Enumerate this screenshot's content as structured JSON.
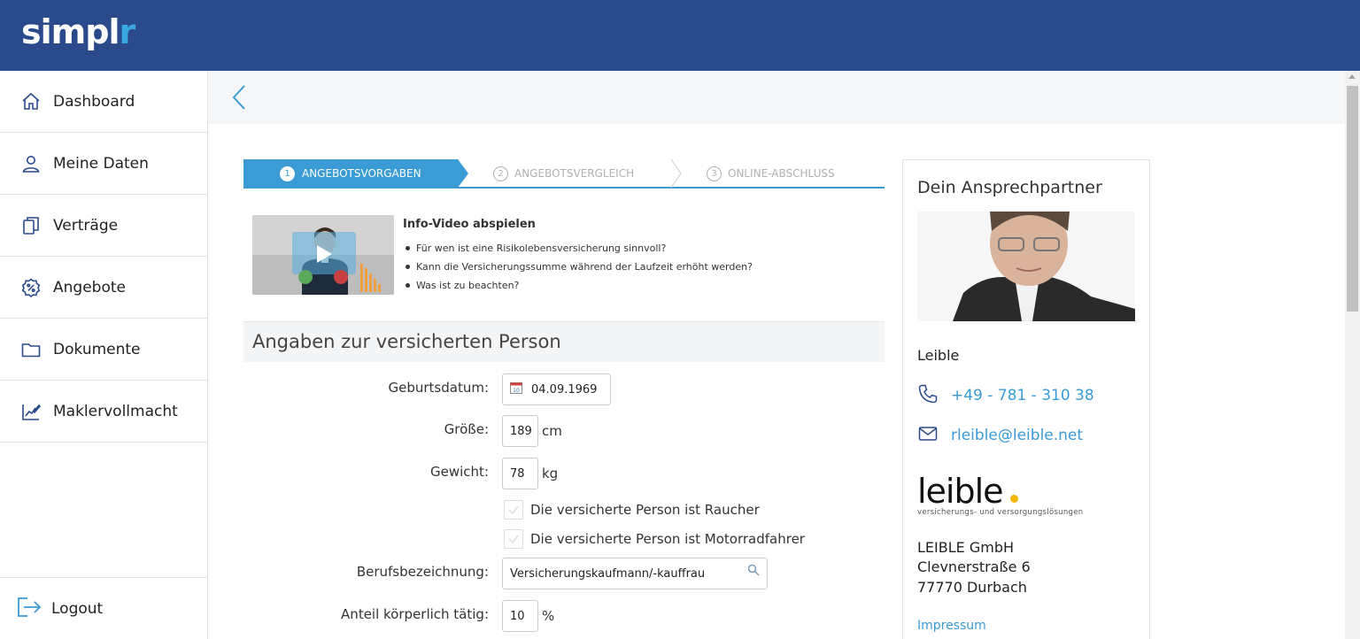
{
  "brand": {
    "logo_main": "simpl",
    "logo_accent": "r"
  },
  "sidebar": {
    "items": [
      {
        "label": "Dashboard",
        "icon": "home-icon"
      },
      {
        "label": "Meine Daten",
        "icon": "user-icon"
      },
      {
        "label": "Verträge",
        "icon": "documents-icon"
      },
      {
        "label": "Angebote",
        "icon": "percent-badge-icon"
      },
      {
        "label": "Dokumente",
        "icon": "folder-icon"
      },
      {
        "label": "Maklervollmacht",
        "icon": "signature-chart-icon"
      }
    ],
    "logout_label": "Logout"
  },
  "steps": [
    {
      "num": "1",
      "label": "ANGEBOTSVORGABEN",
      "active": true
    },
    {
      "num": "2",
      "label": "ANGEBOTSVERGLEICH",
      "active": false
    },
    {
      "num": "3",
      "label": "ONLINE-ABSCHLUSS",
      "active": false
    }
  ],
  "info": {
    "title": "Info-Video abspielen",
    "items": [
      "Für wen ist eine Risikolebensversicherung sinnvoll?",
      "Kann die Versicherungssumme während der Laufzeit erhöht werden?",
      "Was ist zu beachten?"
    ]
  },
  "form": {
    "section_title": "Angaben zur versicherten Person",
    "birthdate_label": "Geburtsdatum:",
    "birthdate_value": "04.09.1969",
    "height_label": "Größe:",
    "height_value": "189",
    "height_unit": "cm",
    "weight_label": "Gewicht:",
    "weight_value": "78",
    "weight_unit": "kg",
    "smoker_label": "Die versicherte Person ist Raucher",
    "motorbike_label": "Die versicherte Person ist Motorradfahrer",
    "job_label": "Berufsbezeichnung:",
    "job_value": "Versicherungskaufmann/-kauffrau",
    "physical_label": "Anteil körperlich tätig:",
    "physical_value": "10",
    "physical_unit": "%"
  },
  "contact": {
    "title": "Dein Ansprechpartner",
    "name": "Leible",
    "phone": "+49 - 781 - 310 38",
    "email": "rleible@leible.net",
    "logo_word": "leible",
    "logo_sub": "versicherungs- und versorgungslösungen",
    "company": "LEIBLE GmbH",
    "street": "Clevnerstraße 6",
    "city": "77770 Durbach",
    "impressum": "Impressum"
  },
  "colors": {
    "header": "#2a4a8c",
    "accent": "#3a9bd5"
  }
}
